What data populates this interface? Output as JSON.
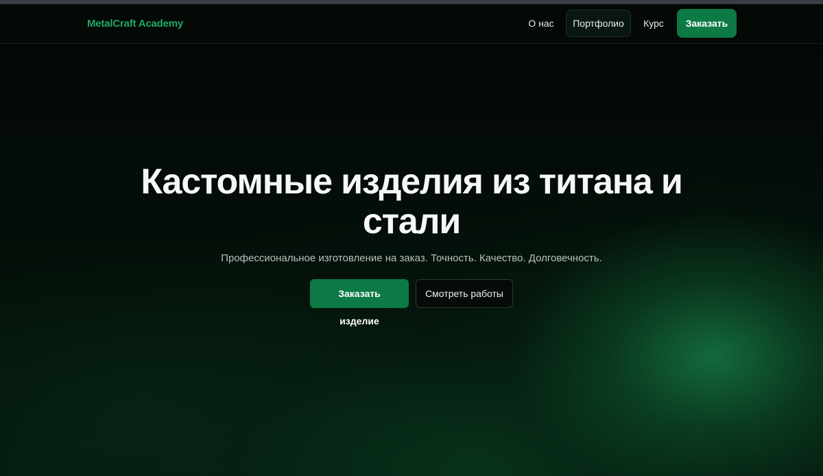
{
  "brand": {
    "name": "MetalCraft Academy"
  },
  "nav": {
    "about": "О нас",
    "portfolio": "Портфолио",
    "course": "Курс",
    "order": "Заказать"
  },
  "hero": {
    "title": "Кастомные изделия из титана и стали",
    "subtitle": "Профессиональное изготовление на заказ. Точность. Качество. Долговечность.",
    "primary_button": "Заказать изделие",
    "secondary_button": "Смотреть работы"
  },
  "colors": {
    "accent": "#0d7a45",
    "brand_text": "#1ea864",
    "background": "#040806"
  }
}
